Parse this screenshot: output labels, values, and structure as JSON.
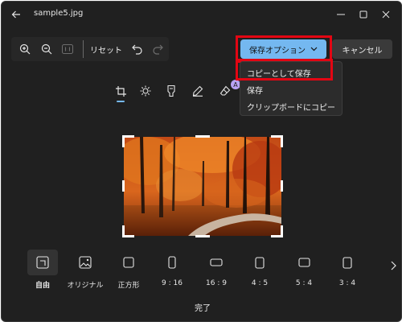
{
  "window": {
    "title": "sample5.jpg",
    "controls": [
      "minimize",
      "maximize",
      "close"
    ]
  },
  "toolbar": {
    "zoom_in_icon": "zoom-in",
    "zoom_out_icon": "zoom-out",
    "actual_size_icon": "actual-size",
    "reset_label": "リセット",
    "undo_icon": "undo",
    "redo_icon": "redo",
    "save_options_label": "保存オプション",
    "cancel_label": "キャンセル"
  },
  "tools": [
    {
      "name": "crop",
      "icon": "crop-icon",
      "active": true
    },
    {
      "name": "adjust",
      "icon": "brightness-icon"
    },
    {
      "name": "filter",
      "icon": "filter-icon"
    },
    {
      "name": "markup",
      "icon": "pen-icon"
    },
    {
      "name": "erase",
      "icon": "eraser-icon"
    }
  ],
  "ai_badge": "A",
  "dropdown": {
    "items": [
      "コピーとして保存",
      "保存",
      "クリップボードにコピー"
    ]
  },
  "aspect_ratios": [
    {
      "label": "自由",
      "selected": true
    },
    {
      "label": "オリジナル"
    },
    {
      "label": "正方形"
    },
    {
      "label": "9 : 16"
    },
    {
      "label": "16 : 9"
    },
    {
      "label": "4 : 5"
    },
    {
      "label": "5 : 4"
    },
    {
      "label": "3 : 4"
    }
  ],
  "done_label": "完了",
  "colors": {
    "background": "#202020",
    "accent": "#74b8f0",
    "highlight": "#e30613",
    "ai_badge": "#b9a2f4"
  }
}
